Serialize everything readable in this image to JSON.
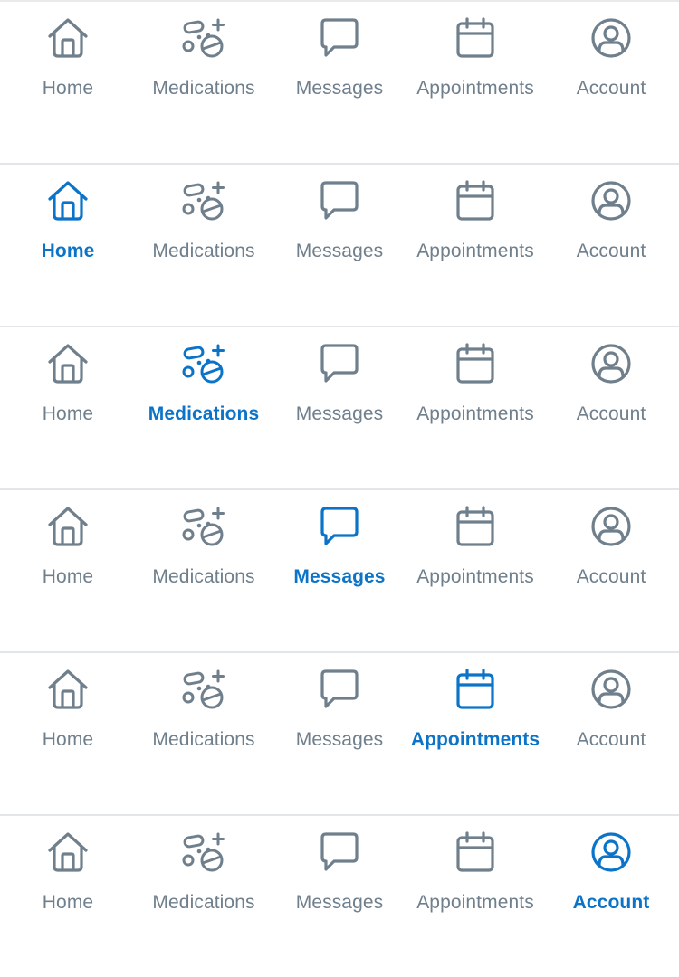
{
  "colors": {
    "inactive": "#6f7f8c",
    "active": "#0b74c8",
    "divider": "#e3e6e8",
    "background": "#ffffff"
  },
  "tabs": [
    {
      "id": "home",
      "label": "Home",
      "icon": "home-icon"
    },
    {
      "id": "medications",
      "label": "Medications",
      "icon": "pills-icon"
    },
    {
      "id": "messages",
      "label": "Messages",
      "icon": "chat-bubble-icon"
    },
    {
      "id": "appointments",
      "label": "Appointments",
      "icon": "calendar-icon"
    },
    {
      "id": "account",
      "label": "Account",
      "icon": "user-circle-icon"
    }
  ],
  "tabbars": [
    {
      "active": null
    },
    {
      "active": "home"
    },
    {
      "active": "medications"
    },
    {
      "active": "messages"
    },
    {
      "active": "appointments"
    },
    {
      "active": "account"
    }
  ]
}
